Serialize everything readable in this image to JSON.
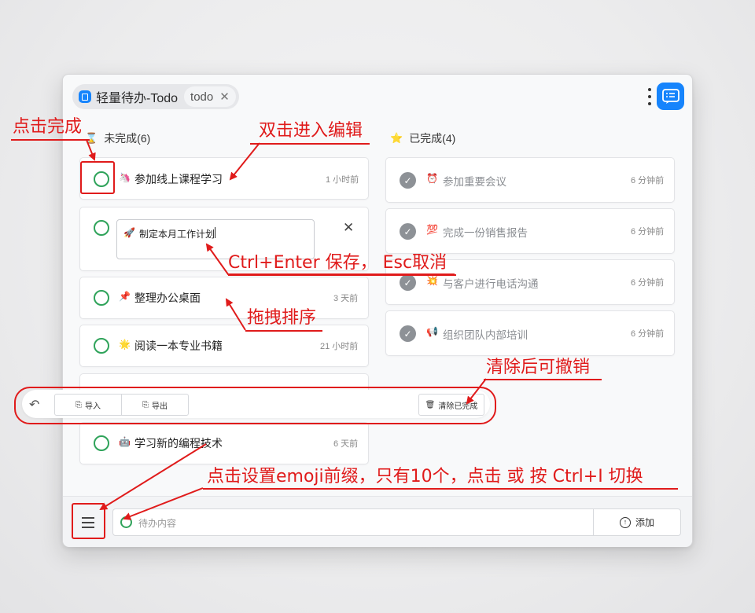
{
  "tabs": {
    "main_label": "轻量待办-Todo",
    "sub_label": "todo"
  },
  "columns": {
    "pending_title": "未完成(6)",
    "done_title": "已完成(4)"
  },
  "pending_tasks": [
    {
      "emoji": "🦄",
      "text": "参加线上课程学习",
      "time": "1 小时前"
    },
    {
      "emoji": "🚀",
      "text": "制定本月工作计划",
      "time": ""
    },
    {
      "emoji": "📌",
      "text": "整理办公桌面",
      "time": "3 天前"
    },
    {
      "emoji": "🌟",
      "text": "阅读一本专业书籍",
      "time": "21 小时前"
    },
    {
      "emoji": "🤖",
      "text": "学习新的编程技术",
      "time": "6 天前"
    }
  ],
  "done_tasks": [
    {
      "emoji": "⏰",
      "text": "参加重要会议",
      "time": "6 分钟前"
    },
    {
      "emoji": "💯",
      "text": "完成一份销售报告",
      "time": "6 分钟前"
    },
    {
      "emoji": "💥",
      "text": "与客户进行电话沟通",
      "time": "6 分钟前"
    },
    {
      "emoji": "📢",
      "text": "组织团队内部培训",
      "time": "6 分钟前"
    }
  ],
  "toolbar": {
    "import_label": "导入",
    "export_label": "导出",
    "clear_label": "清除已完成"
  },
  "bottom": {
    "input_placeholder": "待办内容",
    "add_label": "添加"
  },
  "annotations": {
    "click_complete": "点击完成",
    "double_click_edit": "双击进入编辑",
    "edit_keys": "Ctrl+Enter 保存， Esc取消",
    "drag_sort": "拖拽排序",
    "clear_undo": "清除后可撤销",
    "emoji_prefix": "点击设置emoji前缀，只有10个，点击 或 按 Ctrl+I 切换"
  },
  "colors": {
    "brand": "#1684fc",
    "check_green": "#2fa35a",
    "annotation_red": "#e01b1b"
  }
}
